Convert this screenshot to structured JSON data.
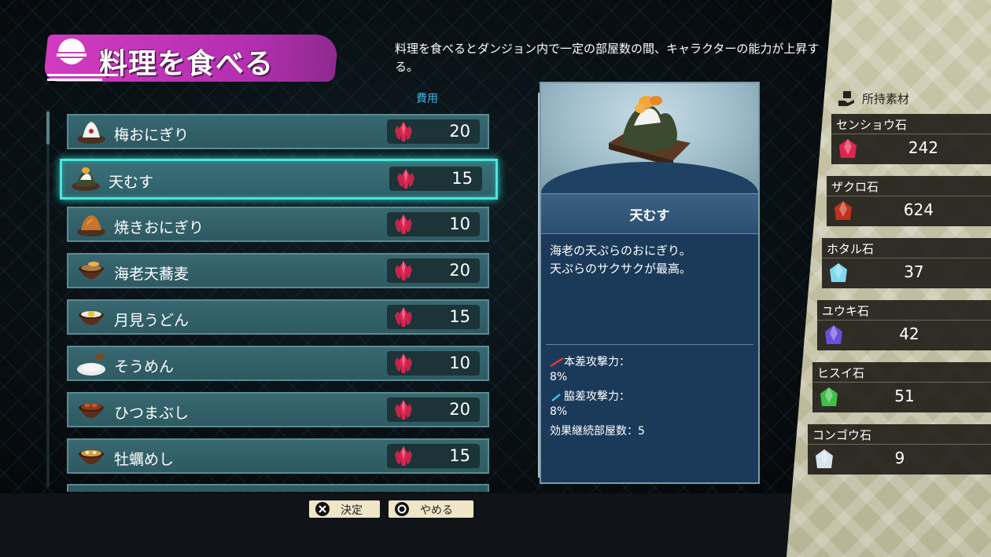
{
  "header": {
    "title": "料理を食べる",
    "description": "料理を食べるとダンジョン内で一定の部屋数の間、キャラクターの能力が上昇する。",
    "cost_label": "費用"
  },
  "menu": {
    "items": [
      {
        "name": "梅おにぎり",
        "cost": "20",
        "icon": "ume-onigiri-icon"
      },
      {
        "name": "天むす",
        "cost": "15",
        "icon": "tenmusu-icon",
        "selected": true
      },
      {
        "name": "焼きおにぎり",
        "cost": "10",
        "icon": "yaki-onigiri-icon"
      },
      {
        "name": "海老天蕎麦",
        "cost": "20",
        "icon": "ebi-ten-soba-icon"
      },
      {
        "name": "月見うどん",
        "cost": "15",
        "icon": "tsukimi-udon-icon"
      },
      {
        "name": "そうめん",
        "cost": "10",
        "icon": "somen-icon"
      },
      {
        "name": "ひつまぶし",
        "cost": "20",
        "icon": "hitsumabushi-icon"
      },
      {
        "name": "牡蠣めし",
        "cost": "15",
        "icon": "kaki-meshi-icon"
      }
    ]
  },
  "detail": {
    "name": "天むす",
    "description_line1": "海老の天ぷらのおにぎり。",
    "description_line2": "天ぷらのサクサクが最高。",
    "stat1_label": "本差攻撃力：",
    "stat1_value": "8%",
    "stat2_label": "脇差攻撃力：",
    "stat2_value": "8%",
    "stat3": "効果継続部屋数：5"
  },
  "materials": {
    "header": "所持素材",
    "items": [
      {
        "name": "センショウ石",
        "count": "242",
        "color": "#e0234f"
      },
      {
        "name": "ザクロ石",
        "count": "624",
        "color": "#c0321e"
      },
      {
        "name": "ホタル石",
        "count": "37",
        "color": "#7fd8f0"
      },
      {
        "name": "ユウキ石",
        "count": "42",
        "color": "#6a4fd8"
      },
      {
        "name": "ヒスイ石",
        "count": "51",
        "color": "#3fbf4a"
      },
      {
        "name": "コンゴウ石",
        "count": "9",
        "color": "#d8e4ec"
      }
    ]
  },
  "footer": {
    "confirm_label": "決定",
    "cancel_label": "やめる"
  },
  "colors": {
    "accent": "#4fe4dc",
    "title_brush": "#c436b8",
    "cost_header": "#3fb6e8",
    "crystal": "#e0234f"
  }
}
